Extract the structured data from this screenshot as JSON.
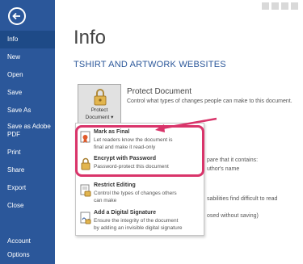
{
  "nav": {
    "items": [
      {
        "label": "Info",
        "active": true
      },
      {
        "label": "New"
      },
      {
        "label": "Open"
      },
      {
        "label": "Save"
      },
      {
        "label": "Save As"
      },
      {
        "label": "Save as Adobe PDF"
      },
      {
        "label": "Print"
      },
      {
        "label": "Share"
      },
      {
        "label": "Export"
      },
      {
        "label": "Close"
      }
    ],
    "bottom": [
      {
        "label": "Account"
      },
      {
        "label": "Options"
      }
    ]
  },
  "main": {
    "title": "Info",
    "doc_title": "TSHIRT AND ARTWORK WEBSITES",
    "protect": {
      "button_line1": "Protect",
      "button_line2": "Document ▾",
      "heading": "Protect Document",
      "description": "Control what types of changes people can make to this document."
    },
    "background_fragments": [
      "pare that it contains:",
      "uthor's name",
      "sabilities find difficult to read",
      "osed without saving)"
    ]
  },
  "menu": {
    "items": [
      {
        "title": "Mark as Final",
        "desc1": "Let readers know the document is",
        "desc2": "final and make it read-only"
      },
      {
        "title": "Encrypt with Password",
        "desc1": "Password-protect this document",
        "desc2": ""
      },
      {
        "title": "Restrict Editing",
        "desc1": "Control the types of changes others",
        "desc2": "can make"
      },
      {
        "title": "Add a Digital Signature",
        "desc1": "Ensure the integrity of the document",
        "desc2": "by adding an invisible digital signature"
      }
    ]
  },
  "colors": {
    "nav_bg": "#2b579a",
    "nav_active": "#1e4a87",
    "accent": "#2b579a",
    "highlight": "#d9346a"
  }
}
